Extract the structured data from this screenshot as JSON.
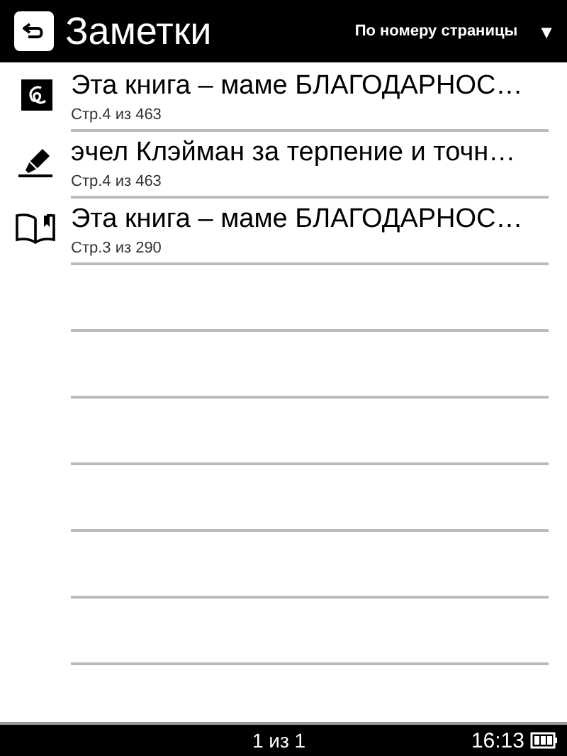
{
  "header": {
    "title": "Заметки",
    "sort": "По номеру страницы",
    "sort_arrow": "▼"
  },
  "notes": [
    {
      "kind": "handwriting",
      "text": "Эта книга – маме БЛАГОДАРНОС…",
      "page": "Стр.4 из 463"
    },
    {
      "kind": "highlight",
      "text": "эчел Клэйман за терпение и точн…",
      "page": "Стр.4 из 463"
    },
    {
      "kind": "bookmark",
      "text": "Эта книга – маме БЛАГОДАРНОС…",
      "page": "Стр.3 из 290"
    }
  ],
  "status_bar": {
    "pages": "1 из 1",
    "time": "16:13"
  }
}
